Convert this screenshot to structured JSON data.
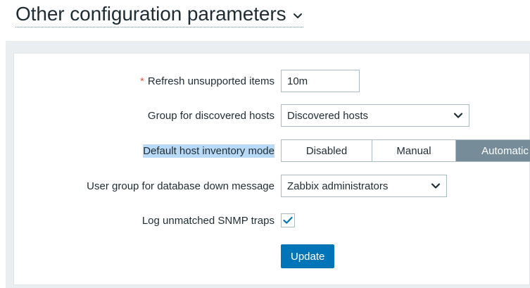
{
  "header": {
    "title": "Other configuration parameters",
    "chevron_icon": "chevron-down-icon"
  },
  "form": {
    "refresh_unsupported": {
      "label": "Refresh unsupported items",
      "required_mark": "*",
      "value": "10m"
    },
    "discovered_hosts_group": {
      "label": "Group for discovered hosts",
      "selected": "Discovered hosts"
    },
    "inventory_mode": {
      "label": "Default host inventory mode",
      "options": [
        "Disabled",
        "Manual",
        "Automatic"
      ],
      "selected": "Automatic"
    },
    "db_down_user_group": {
      "label": "User group for database down message",
      "selected": "Zabbix administrators"
    },
    "log_snmp_traps": {
      "label": "Log unmatched SNMP traps",
      "checked": true
    },
    "update_button": "Update"
  },
  "colors": {
    "accent": "#0275b8",
    "selected_segment": "#768d99",
    "label_highlight": "#b9daf6",
    "required": "#e45959"
  }
}
